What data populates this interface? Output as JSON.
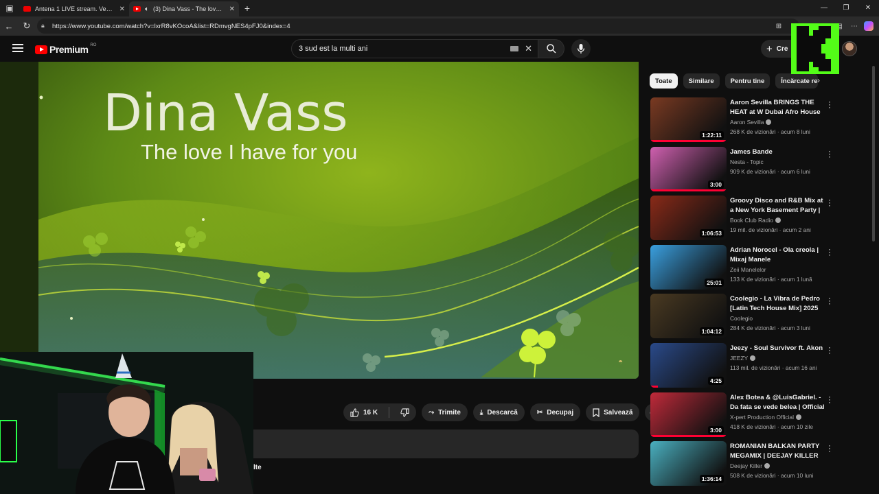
{
  "browser": {
    "tabs": [
      {
        "title": "Antena 1 LIVE stream. Vezi online",
        "active": false
      },
      {
        "title": "(3) Dina Vass - The love I have",
        "active": true
      }
    ],
    "url": "https://www.youtube.com/watch?v=lxrR8vKOcoA&list=RDmvgNES4pFJ0&index=4"
  },
  "header": {
    "logo_text": "Premium",
    "region_code": "RO",
    "search_value": "3 sud est la multi ani",
    "create_label": "Cre"
  },
  "video": {
    "title_text": "Dina Vass",
    "subtitle_text": "The love I have for you",
    "likes": "16 K",
    "share_label": "Trimite",
    "download_label": "Descarcă",
    "clip_label": "Decupaj",
    "save_label": "Salvează",
    "description_more": "lte"
  },
  "chips": [
    "Toate",
    "Similare",
    "Pentru tine",
    "Încărcate rec"
  ],
  "recommendations": [
    {
      "title": "Aaron Sevilla BRINGS THE HEAT at W Dubai Afro House ...",
      "channel": "Aaron Sevilla",
      "verified": true,
      "stats": "268 K de vizionări · acum 8 luni",
      "duration": "1:22:11",
      "progress": 1.0
    },
    {
      "title": "James Bande",
      "channel": "Nesta - Topic",
      "verified": false,
      "stats": "909 K de vizionări · acum 6 luni",
      "duration": "3:00",
      "progress": 1.0
    },
    {
      "title": "Groovy Disco and R&B Mix at a New York Basement Party | ...",
      "channel": "Book Club Radio",
      "verified": true,
      "stats": "19 mil. de vizionări · acum 2 ani",
      "duration": "1:06:53",
      "progress": 0
    },
    {
      "title": "Adrian Norocel - Ola creola | Mixaj Manele",
      "channel": "Zeii Manelelor",
      "verified": false,
      "stats": "133 K de vizionări · acum 1 lună",
      "duration": "25:01",
      "progress": 0
    },
    {
      "title": "Coolegio - La Vibra de Pedro [Latin Tech House Mix] 2025",
      "channel": "Coolegio",
      "verified": false,
      "stats": "284 K de vizionări · acum 3 luni",
      "duration": "1:04:12",
      "progress": 0
    },
    {
      "title": "Jeezy - Soul Survivor ft. Akon",
      "channel": "JEEZY",
      "verified": true,
      "stats": "113 mil. de vizionări · acum 16 ani",
      "duration": "4:25",
      "progress": 0.1
    },
    {
      "title": "Alex Botea & @LuisGabriel. - Da fata se vede belea | Official ...",
      "channel": "X-pert Production Official",
      "verified": true,
      "stats": "418 K de vizionări · acum 10 zile",
      "duration": "3:00",
      "progress": 1.0
    },
    {
      "title": "ROMANIAN BALKAN PARTY MEGAMIX | DEEJAY KILLER",
      "channel": "Deejay Killer",
      "verified": true,
      "stats": "508 K de vizionări · acum 10 luni",
      "duration": "1:36:14",
      "progress": 0
    }
  ],
  "thumb_colors": [
    "#7a3a22",
    "#d060b0",
    "#8a2a18",
    "#3aa0e0",
    "#4a3a22",
    "#2a4a8a",
    "#c02a3a",
    "#4ab0c0"
  ],
  "colors": {
    "accent": "#ff0033",
    "kick": "#53fc18",
    "video_green": "#6a9a1a"
  }
}
